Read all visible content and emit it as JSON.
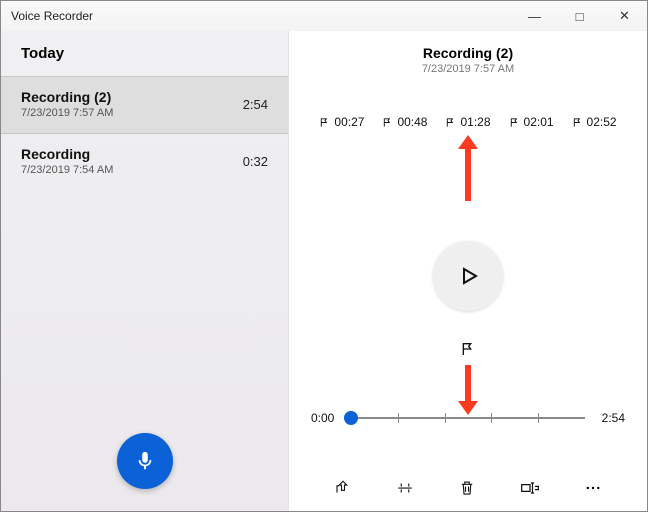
{
  "window": {
    "title": "Voice Recorder",
    "controls": {
      "min": "—",
      "max": "□",
      "close": "✕"
    }
  },
  "sidebar": {
    "header": "Today",
    "recordings": [
      {
        "title": "Recording (2)",
        "date": "7/23/2019 7:57 AM",
        "duration": "2:54",
        "selected": true
      },
      {
        "title": "Recording",
        "date": "7/23/2019 7:54 AM",
        "duration": "0:32",
        "selected": false
      }
    ]
  },
  "player": {
    "title": "Recording (2)",
    "date": "7/23/2019 7:57 AM",
    "markers": [
      "00:27",
      "00:48",
      "01:28",
      "02:01",
      "02:52"
    ],
    "timeline": {
      "start": "0:00",
      "end": "2:54"
    },
    "actions": {
      "share": "share",
      "trim": "trim",
      "delete": "delete",
      "rename": "rename",
      "more": "more"
    }
  },
  "colors": {
    "accent": "#0b62d6",
    "arrow": "#ff3b1f"
  }
}
